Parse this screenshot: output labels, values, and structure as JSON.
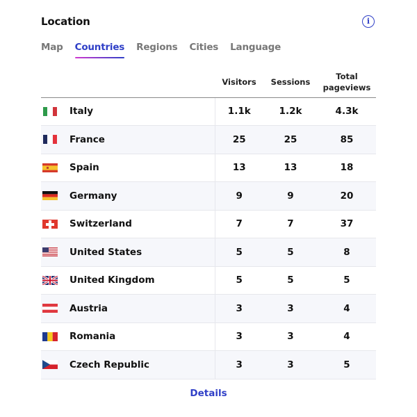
{
  "header": {
    "title": "Location",
    "info_icon": "info-circle-icon"
  },
  "tabs": [
    {
      "label": "Map",
      "active": false
    },
    {
      "label": "Countries",
      "active": true
    },
    {
      "label": "Regions",
      "active": false
    },
    {
      "label": "Cities",
      "active": false
    },
    {
      "label": "Language",
      "active": false
    }
  ],
  "table": {
    "columns": {
      "name": "",
      "visitors": "Visitors",
      "sessions": "Sessions",
      "pageviews_line1": "Total",
      "pageviews_line2": "pageviews"
    },
    "rows": [
      {
        "country": "Italy",
        "flag": "flag-italy",
        "visitors": "1.1k",
        "sessions": "1.2k",
        "pageviews": "4.3k"
      },
      {
        "country": "France",
        "flag": "flag-france",
        "visitors": "25",
        "sessions": "25",
        "pageviews": "85"
      },
      {
        "country": "Spain",
        "flag": "flag-spain",
        "visitors": "13",
        "sessions": "13",
        "pageviews": "18"
      },
      {
        "country": "Germany",
        "flag": "flag-germany",
        "visitors": "9",
        "sessions": "9",
        "pageviews": "20"
      },
      {
        "country": "Switzerland",
        "flag": "flag-switzerland",
        "visitors": "7",
        "sessions": "7",
        "pageviews": "37"
      },
      {
        "country": "United States",
        "flag": "flag-united-states",
        "visitors": "5",
        "sessions": "5",
        "pageviews": "8"
      },
      {
        "country": "United Kingdom",
        "flag": "flag-united-kingdom",
        "visitors": "5",
        "sessions": "5",
        "pageviews": "5"
      },
      {
        "country": "Austria",
        "flag": "flag-austria",
        "visitors": "3",
        "sessions": "3",
        "pageviews": "4"
      },
      {
        "country": "Romania",
        "flag": "flag-romania",
        "visitors": "3",
        "sessions": "3",
        "pageviews": "4"
      },
      {
        "country": "Czech Republic",
        "flag": "flag-czech-republic",
        "visitors": "3",
        "sessions": "3",
        "pageviews": "5"
      }
    ]
  },
  "footer": {
    "details_label": "Details"
  },
  "colors": {
    "accent": "#2f3fc7",
    "underline_start": "#d13ad0",
    "row_alt": "#f6f7fb"
  }
}
